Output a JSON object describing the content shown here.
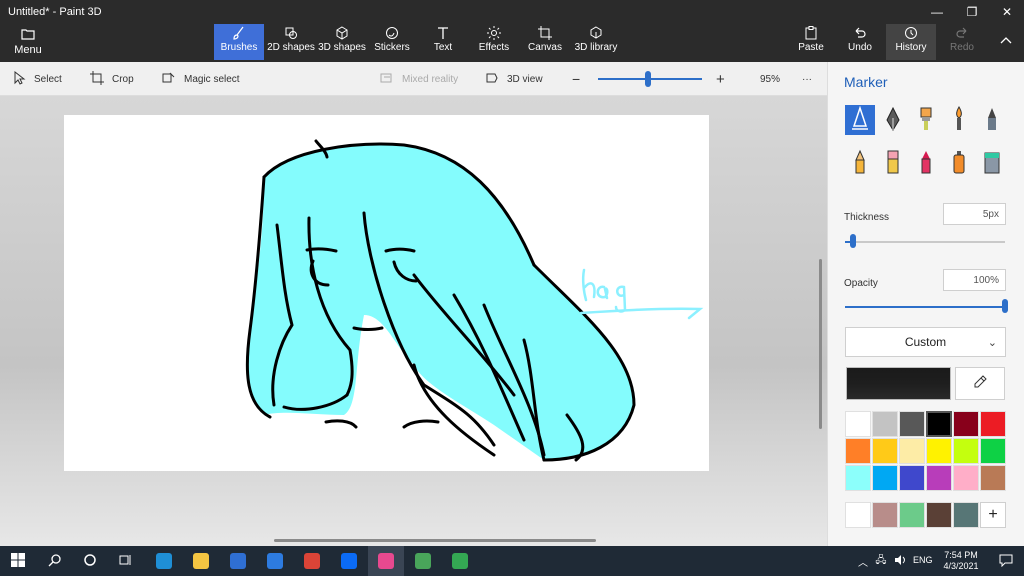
{
  "window": {
    "title": "Untitled* - Paint 3D",
    "controls": [
      "minimize-icon",
      "restore-icon",
      "close-icon"
    ]
  },
  "ribbon": {
    "menu_label": "Menu",
    "tabs": [
      {
        "label": "Brushes",
        "icon": "brush-icon",
        "active": true
      },
      {
        "label": "2D shapes",
        "icon": "shapes-2d-icon"
      },
      {
        "label": "3D shapes",
        "icon": "cube-icon"
      },
      {
        "label": "Stickers",
        "icon": "sticker-icon"
      },
      {
        "label": "Text",
        "icon": "text-icon"
      },
      {
        "label": "Effects",
        "icon": "sun-icon"
      },
      {
        "label": "Canvas",
        "icon": "canvas-icon"
      },
      {
        "label": "3D library",
        "icon": "library-icon"
      }
    ],
    "right": [
      {
        "label": "Paste",
        "icon": "paste-icon"
      },
      {
        "label": "Undo",
        "icon": "undo-icon"
      },
      {
        "label": "History",
        "icon": "history-icon"
      },
      {
        "label": "Redo",
        "icon": "redo-icon",
        "disabled": true
      }
    ]
  },
  "toolbar": {
    "select": "Select",
    "crop": "Crop",
    "magic_select": "Magic select",
    "mixed_reality": "Mixed reality",
    "view_3d": "3D view",
    "zoom_percent": "95%",
    "zoom_level": 0.5,
    "more": "···"
  },
  "canvas": {
    "signature_text": "hag",
    "hair_color": "#84fcfd",
    "outline_color": "#000000"
  },
  "panel": {
    "title": "Marker",
    "brushes": [
      {
        "name": "marker-icon",
        "selected": true
      },
      {
        "name": "calligraphy-pen-icon"
      },
      {
        "name": "oil-brush-icon"
      },
      {
        "name": "watercolor-icon"
      },
      {
        "name": "pixel-pen-icon"
      },
      {
        "name": "pencil-icon"
      },
      {
        "name": "eraser-icon"
      },
      {
        "name": "crayon-icon"
      },
      {
        "name": "spray-can-icon"
      },
      {
        "name": "fill-bucket-icon"
      }
    ],
    "thickness_label": "Thickness",
    "thickness_value": "5px",
    "thickness_fraction": 0.03,
    "opacity_label": "Opacity",
    "opacity_value": "100%",
    "opacity_fraction": 1.0,
    "color_mode": "Custom",
    "current_color": "#1e1e1e",
    "palette": [
      "#ffffff",
      "#c3c3c3",
      "#585858",
      "#000000",
      "#88001b",
      "#ec1c24",
      "#ff7f27",
      "#ffca18",
      "#fdeca6",
      "#fff200",
      "#c4ff0e",
      "#0ed145",
      "#8cfffb",
      "#00a8f3",
      "#3f48cc",
      "#b83dba",
      "#ffaec8",
      "#b97a56"
    ],
    "custom_colors": [
      "#ffffff",
      "#b88d8a",
      "#6ccb8a",
      "#5a4036",
      "#577676"
    ],
    "add_color": "+"
  },
  "taskbar": {
    "apps": [
      {
        "name": "start-icon"
      },
      {
        "name": "search-icon"
      },
      {
        "name": "cortana-icon"
      },
      {
        "name": "task-view-icon"
      },
      {
        "name": "edge-icon",
        "color": "#1f8fd6"
      },
      {
        "name": "file-explorer-icon",
        "color": "#f4c542"
      },
      {
        "name": "store-icon",
        "color": "#2f6fd3"
      },
      {
        "name": "mail-icon",
        "color": "#2d7be0"
      },
      {
        "name": "chrome-icon",
        "color": "#db4437"
      },
      {
        "name": "zalo-icon",
        "color": "#0b6bf5"
      },
      {
        "name": "paint3d-icon",
        "color": "#e8498f",
        "active": true
      },
      {
        "name": "app-icon",
        "color": "#49a55a"
      },
      {
        "name": "chrome-alt-icon",
        "color": "#34a853"
      }
    ],
    "lang": "ENG",
    "time": "7:54 PM",
    "date": "4/3/2021"
  }
}
